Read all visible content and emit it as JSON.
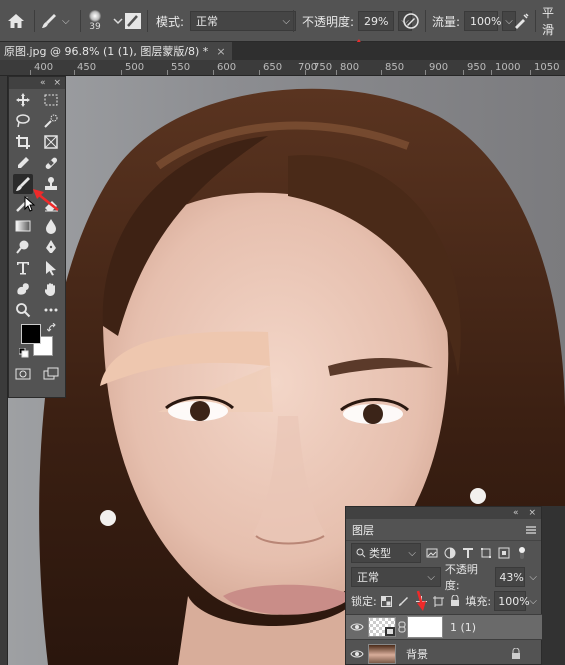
{
  "options_bar": {
    "brush_size": "39",
    "mode_label": "模式:",
    "mode_value": "正常",
    "opacity_label": "不透明度:",
    "opacity_value": "29%",
    "flow_label": "流量:",
    "flow_value": "100%",
    "smoothing_label": "平滑"
  },
  "tab": {
    "title": "原图.jpg @ 96.8% (1 (1), 图层蒙版/8) *",
    "close": "×"
  },
  "ruler": {
    "labels": [
      "400",
      "450",
      "500",
      "550",
      "600",
      "650",
      "700",
      "750",
      "800",
      "850",
      "900",
      "950",
      "1000",
      "1050"
    ]
  },
  "toolbar": {
    "collapse": "«",
    "close": "×"
  },
  "layers_panel": {
    "tab_label": "图层",
    "collapse": "«",
    "close": "×",
    "filter_type": "类型",
    "blend_mode": "正常",
    "opacity_label": "不透明度:",
    "opacity_value": "43%",
    "lock_label": "锁定:",
    "fill_label": "填充:",
    "fill_value": "100%",
    "layers": [
      {
        "name": "1 (1)",
        "selected": true
      },
      {
        "name": "背景",
        "selected": false
      }
    ]
  },
  "colors": {
    "panel_bg": "#535353",
    "dark_bg": "#323232",
    "highlight": "#ef2a2a",
    "foreground_color": "#000000",
    "background_color": "#ffffff",
    "brow_patch": "#eec7af"
  }
}
